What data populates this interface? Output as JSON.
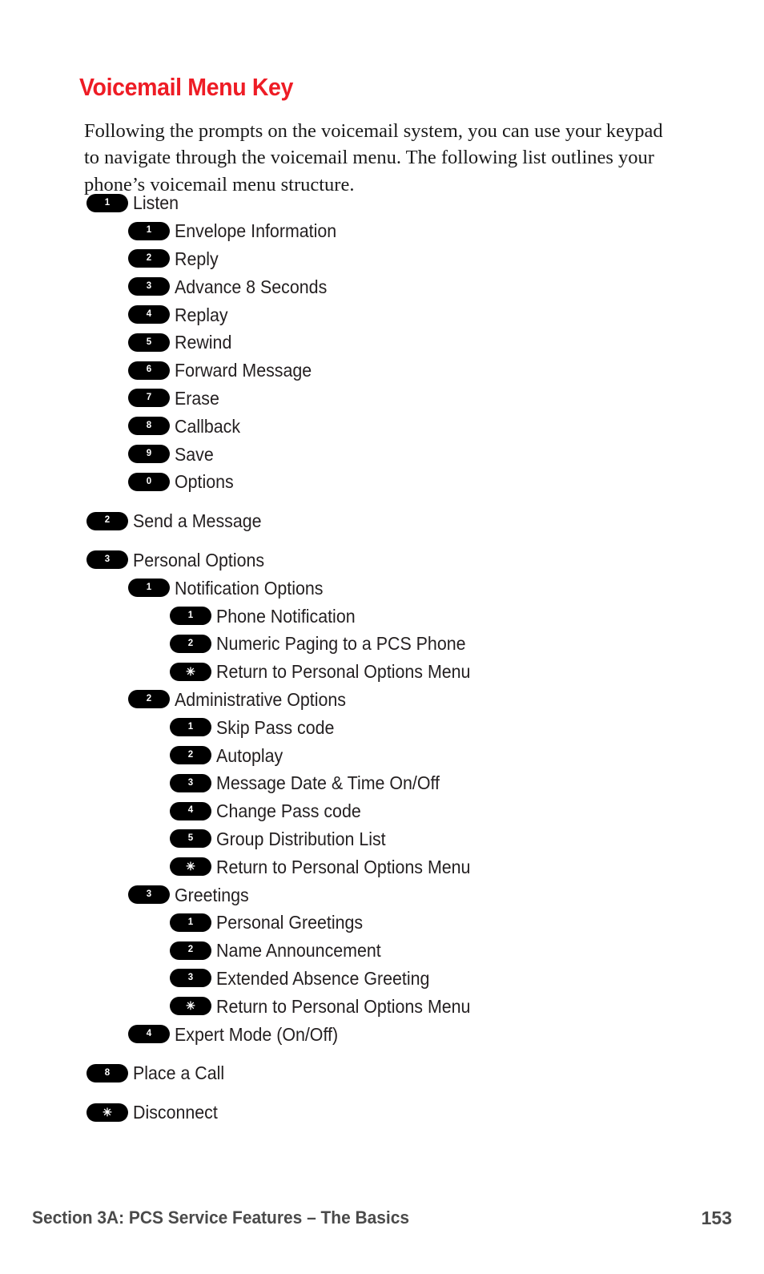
{
  "document": {
    "title": "Voicemail Menu Key",
    "title_color": "#ee1c25",
    "intro": "Following the prompts on the voicemail system, you can use your keypad to navigate through the voicemail menu. The following list outlines your phone’s voicemail menu structure."
  },
  "outline": [
    {
      "key": "1",
      "label": "Listen",
      "level": 1,
      "gap_before": false
    },
    {
      "key": "1",
      "label": "Envelope Information",
      "level": 2,
      "gap_before": false
    },
    {
      "key": "2",
      "label": "Reply",
      "level": 2,
      "gap_before": false
    },
    {
      "key": "3",
      "label": "Advance 8 Seconds",
      "level": 2,
      "gap_before": false
    },
    {
      "key": "4",
      "label": "Replay",
      "level": 2,
      "gap_before": false
    },
    {
      "key": "5",
      "label": "Rewind",
      "level": 2,
      "gap_before": false
    },
    {
      "key": "6",
      "label": "Forward Message",
      "level": 2,
      "gap_before": false
    },
    {
      "key": "7",
      "label": "Erase",
      "level": 2,
      "gap_before": false
    },
    {
      "key": "8",
      "label": "Callback",
      "level": 2,
      "gap_before": false
    },
    {
      "key": "9",
      "label": "Save",
      "level": 2,
      "gap_before": false
    },
    {
      "key": "0",
      "label": "Options",
      "level": 2,
      "gap_before": false
    },
    {
      "key": "2",
      "label": "Send a Message",
      "level": 1,
      "gap_before": true
    },
    {
      "key": "3",
      "label": "Personal Options",
      "level": 1,
      "gap_before": true
    },
    {
      "key": "1",
      "label": "Notification Options",
      "level": 2,
      "gap_before": false
    },
    {
      "key": "1",
      "label": "Phone Notification",
      "level": 3,
      "gap_before": false
    },
    {
      "key": "2",
      "label": "Numeric Paging to a PCS Phone",
      "level": 3,
      "gap_before": false
    },
    {
      "key": "✳",
      "label": "Return to Personal Options Menu",
      "level": 3,
      "gap_before": false
    },
    {
      "key": "2",
      "label": "Administrative Options",
      "level": 2,
      "gap_before": false
    },
    {
      "key": "1",
      "label": "Skip Pass code",
      "level": 3,
      "gap_before": false
    },
    {
      "key": "2",
      "label": "Autoplay",
      "level": 3,
      "gap_before": false
    },
    {
      "key": "3",
      "label": "Message Date & Time On/Off",
      "level": 3,
      "gap_before": false
    },
    {
      "key": "4",
      "label": "Change Pass code",
      "level": 3,
      "gap_before": false
    },
    {
      "key": "5",
      "label": "Group Distribution List",
      "level": 3,
      "gap_before": false
    },
    {
      "key": "✳",
      "label": "Return to Personal Options Menu",
      "level": 3,
      "gap_before": false
    },
    {
      "key": "3",
      "label": "Greetings",
      "level": 2,
      "gap_before": false
    },
    {
      "key": "1",
      "label": "Personal Greetings",
      "level": 3,
      "gap_before": false
    },
    {
      "key": "2",
      "label": "Name Announcement",
      "level": 3,
      "gap_before": false
    },
    {
      "key": "3",
      "label": "Extended Absence Greeting",
      "level": 3,
      "gap_before": false
    },
    {
      "key": "✳",
      "label": "Return to Personal Options Menu",
      "level": 3,
      "gap_before": false
    },
    {
      "key": "4",
      "label": "Expert Mode  (On/Off)",
      "level": 2,
      "gap_before": false
    },
    {
      "key": "8",
      "label": "Place a Call",
      "level": 1,
      "gap_before": true
    },
    {
      "key": "✳",
      "label": "Disconnect",
      "level": 1,
      "gap_before": true
    }
  ],
  "footer": {
    "section": "Section 3A: PCS Service Features – The Basics",
    "page_number": "153"
  }
}
